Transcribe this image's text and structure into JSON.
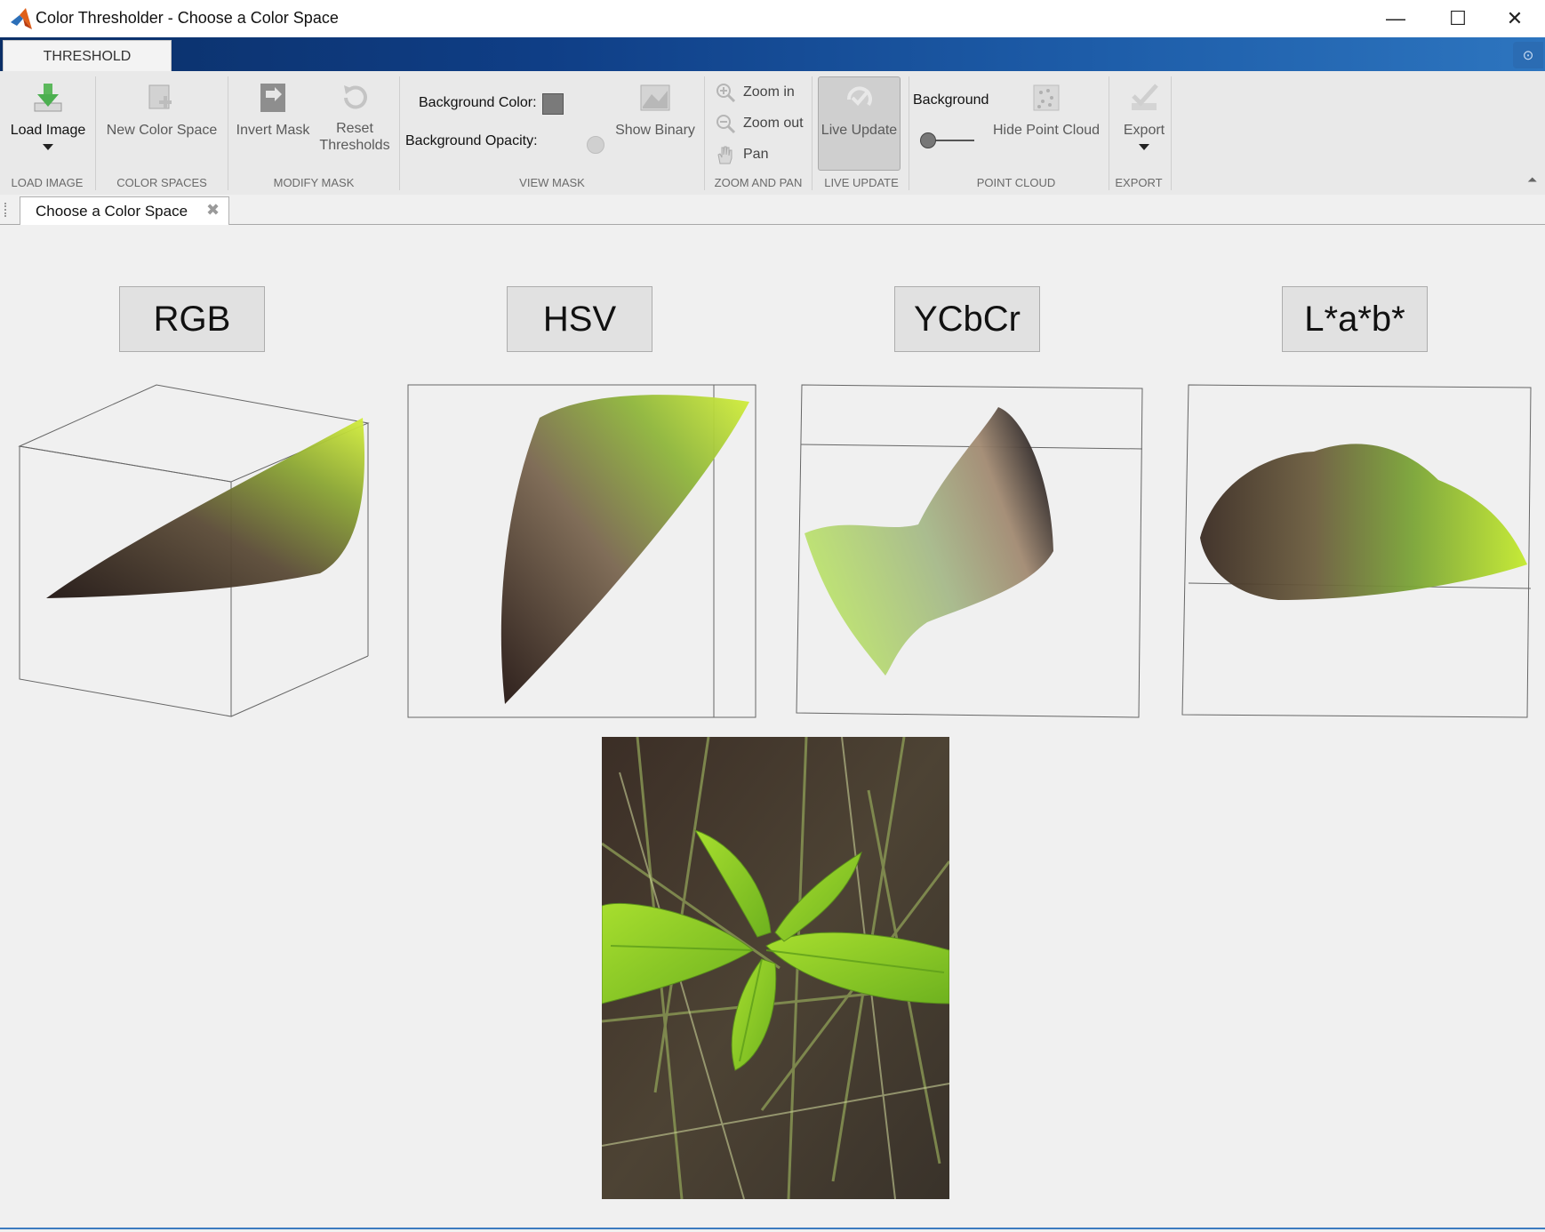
{
  "window": {
    "title": "Color Thresholder - Choose a Color Space",
    "controls": {
      "minimize": "—",
      "maximize": "☐",
      "close": "✕"
    }
  },
  "ribbon": {
    "tab": "THRESHOLD",
    "sections": {
      "load_image": {
        "label": "LOAD IMAGE",
        "button": "Load Image"
      },
      "color_spaces": {
        "label": "COLOR SPACES",
        "button": "New Color Space"
      },
      "modify_mask": {
        "label": "MODIFY MASK",
        "invert": "Invert Mask",
        "reset_line1": "Reset",
        "reset_line2": "Thresholds"
      },
      "view_mask": {
        "label": "VIEW MASK",
        "bg_color": "Background Color:",
        "bg_opacity": "Background Opacity:",
        "show_binary": "Show Binary"
      },
      "zoom_pan": {
        "label": "ZOOM AND PAN",
        "zoom_in": "Zoom in",
        "zoom_out": "Zoom out",
        "pan": "Pan"
      },
      "live_update": {
        "label": "LIVE UPDATE",
        "button": "Live Update"
      },
      "point_cloud": {
        "label": "POINT CLOUD",
        "background": "Background",
        "hide": "Hide Point Cloud"
      },
      "export": {
        "label": "EXPORT",
        "button": "Export"
      }
    }
  },
  "document_tab": {
    "label": "Choose a Color Space"
  },
  "color_spaces": [
    {
      "label": "RGB"
    },
    {
      "label": "HSV"
    },
    {
      "label": "YCbCr"
    },
    {
      "label": "L*a*b*"
    }
  ],
  "icons": [
    "matlab-logo-icon",
    "load-image-icon",
    "new-color-space-icon",
    "invert-mask-icon",
    "reset-thresholds-icon",
    "background-color-swatch",
    "show-binary-icon",
    "zoom-in-icon",
    "zoom-out-icon",
    "pan-icon",
    "live-update-icon",
    "hide-point-cloud-icon",
    "export-icon",
    "help-icon"
  ],
  "colors": {
    "ribbon_blue": "#0f3e86",
    "accent_green": "#b6e01f",
    "dark_brown": "#2d1f17"
  }
}
